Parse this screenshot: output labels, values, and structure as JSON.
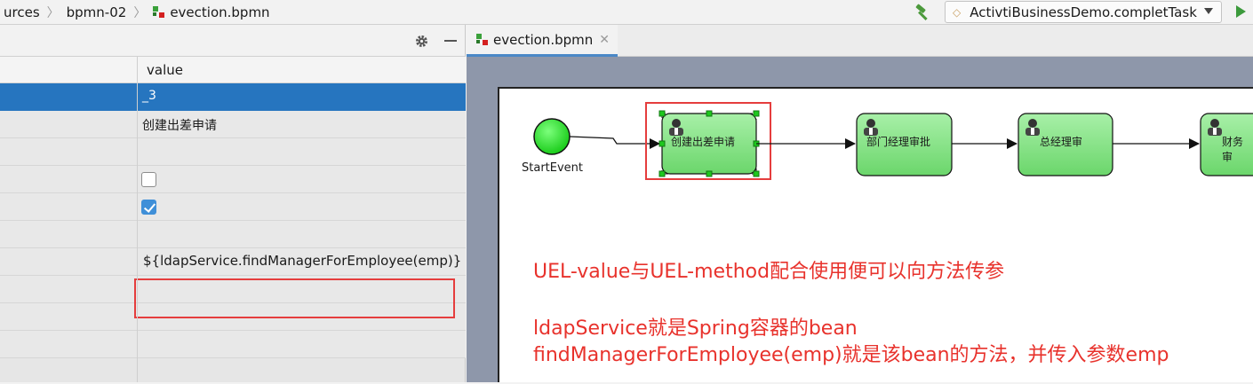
{
  "breadcrumb": {
    "items": [
      "urces",
      "bpmn-02",
      "evection.bpmn"
    ]
  },
  "run_config": {
    "label": "ActivtiBusinessDemo.completTask"
  },
  "properties": {
    "value_header": "value",
    "rows": [
      {
        "value": "_3",
        "kind": "text",
        "selected": true
      },
      {
        "value": "创建出差申请",
        "kind": "text"
      },
      {
        "value": "",
        "kind": "text"
      },
      {
        "value": "",
        "kind": "checkbox",
        "checked": false
      },
      {
        "value": "",
        "kind": "checkbox",
        "checked": true
      },
      {
        "value": "",
        "kind": "text"
      },
      {
        "value": "${ldapService.findManagerForEmployee(emp)}",
        "kind": "text",
        "highlighted": true
      },
      {
        "value": "",
        "kind": "text"
      },
      {
        "value": "",
        "kind": "text"
      },
      {
        "value": "",
        "kind": "text"
      }
    ]
  },
  "editor": {
    "tab_label": "evection.bpmn",
    "diagram": {
      "start_event_label": "StartEvent",
      "tasks": [
        "创建出差申请",
        "部门经理审批",
        "总经理审",
        "财务审"
      ]
    },
    "notes": [
      "UEL-value与UEL-method配合使用便可以向方法传参",
      "ldapService就是Spring容器的bean",
      "findManagerForEmployee(emp)就是该bean的方法，并传入参数emp"
    ]
  },
  "colors": {
    "selection": "#2675bf",
    "annotation_red": "#e8322c",
    "task_green": "#7bdc7b",
    "start_green": "#22d622"
  }
}
